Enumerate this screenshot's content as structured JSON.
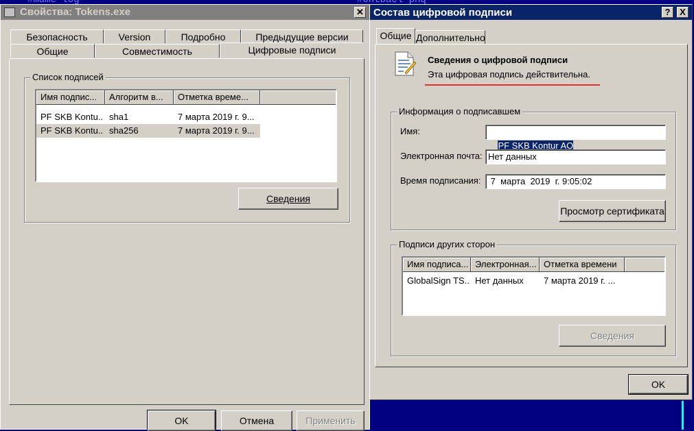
{
  "background_text": {
    "left": "#mame log",
    "right": "#ontbacl pnq"
  },
  "properties": {
    "title": "Свойства: Tokens.exe",
    "tabs_row1": [
      "Безопасность",
      "Version",
      "Подробно",
      "Предыдущие версии"
    ],
    "tabs_row2": [
      "Общие",
      "Совместимость",
      "Цифровые подписи"
    ],
    "group_label": "Список подписей",
    "columns": [
      "Имя подпис...",
      "Алгоритм в...",
      "Отметка време..."
    ],
    "rows": [
      [
        "PF SKB Kontu...",
        "sha1",
        "7 марта 2019 г. 9..."
      ],
      [
        "PF SKB Kontu...",
        "sha256",
        "7 марта 2019 г. 9..."
      ]
    ],
    "details_button": "Сведения",
    "ok": "OK",
    "cancel": "Отмена",
    "apply": "Применить"
  },
  "signature": {
    "title": "Состав цифровой подписи",
    "help": "?",
    "close": "X",
    "tabs": [
      "Общие",
      "Дополнительно"
    ],
    "header_title": "Сведения о цифровой подписи",
    "header_status": "Эта цифровая подпись действительна.",
    "signer_group": "Информация о подписавшем",
    "name_label": "Имя:",
    "name_value": "PF SKB Kontur AO",
    "email_label": "Электронная почта:",
    "email_value": "Нет данных",
    "time_label": "Время подписания:",
    "time_value": " 7  марта  2019  г. 9:05:02",
    "view_cert": "Просмотр сертификата",
    "counter_group": "Подписи других сторон",
    "counter_columns": [
      "Имя подписа...",
      "Электронная...",
      "Отметка времени"
    ],
    "counter_rows": [
      [
        "GlobalSign TS...",
        "Нет данных",
        "7 марта 2019 г. ..."
      ]
    ],
    "counter_details": "Сведения",
    "ok": "OK"
  },
  "colors": {
    "active_title": "#0a246a",
    "inactive_title": "#808080",
    "desktop": "#000080",
    "underline_red": "#e03030"
  }
}
